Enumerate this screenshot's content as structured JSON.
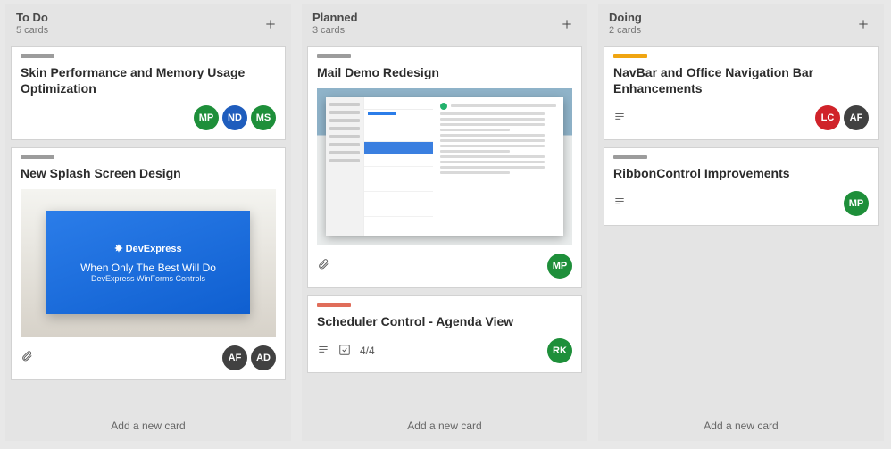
{
  "colors": {
    "green": "#1e8f3a",
    "blue": "#1f5dbd",
    "dark": "#414141",
    "red": "#d0232a",
    "orange": "#f0a511",
    "grey": "#9c9c9c",
    "salmon": "#e06d5a"
  },
  "common": {
    "add_card": "Add a new card"
  },
  "preview": {
    "brand": "✸ DevExpress",
    "tagline": "When Only The Best Will Do",
    "sub": "DevExpress WinForms Controls"
  },
  "columns": [
    {
      "title": "To Do",
      "count": "5 cards",
      "cards": [
        {
          "stripe": "grey",
          "title": "Skin Performance and Memory Usage Optimization",
          "footer_icons": [],
          "avatars": [
            {
              "initials": "MP",
              "color": "green"
            },
            {
              "initials": "ND",
              "color": "blue"
            },
            {
              "initials": "MS",
              "color": "green"
            }
          ]
        },
        {
          "stripe": "grey",
          "title": "New Splash Screen Design",
          "preview": "splash",
          "footer_icons": [
            "attach"
          ],
          "avatars": [
            {
              "initials": "AF",
              "color": "dark"
            },
            {
              "initials": "AD",
              "color": "dark"
            }
          ]
        }
      ]
    },
    {
      "title": "Planned",
      "count": "3 cards",
      "cards": [
        {
          "stripe": "grey",
          "title": "Mail Demo Redesign",
          "preview": "mail",
          "footer_icons": [
            "attach"
          ],
          "avatars": [
            {
              "initials": "MP",
              "color": "green"
            }
          ]
        },
        {
          "stripe": "salmon",
          "title": "Scheduler Control - Agenda View",
          "footer_icons": [
            "desc",
            "check"
          ],
          "check_count": "4/4",
          "avatars": [
            {
              "initials": "RK",
              "color": "green"
            }
          ]
        }
      ]
    },
    {
      "title": "Doing",
      "count": "2 cards",
      "cards": [
        {
          "stripe": "orange",
          "title": "NavBar and Office Navigation Bar Enhancements",
          "footer_icons": [
            "desc"
          ],
          "avatars": [
            {
              "initials": "LC",
              "color": "red"
            },
            {
              "initials": "AF",
              "color": "dark"
            }
          ]
        },
        {
          "stripe": "grey",
          "title": "RibbonControl Improvements",
          "footer_icons": [
            "desc"
          ],
          "avatars": [
            {
              "initials": "MP",
              "color": "green"
            }
          ]
        }
      ]
    }
  ]
}
